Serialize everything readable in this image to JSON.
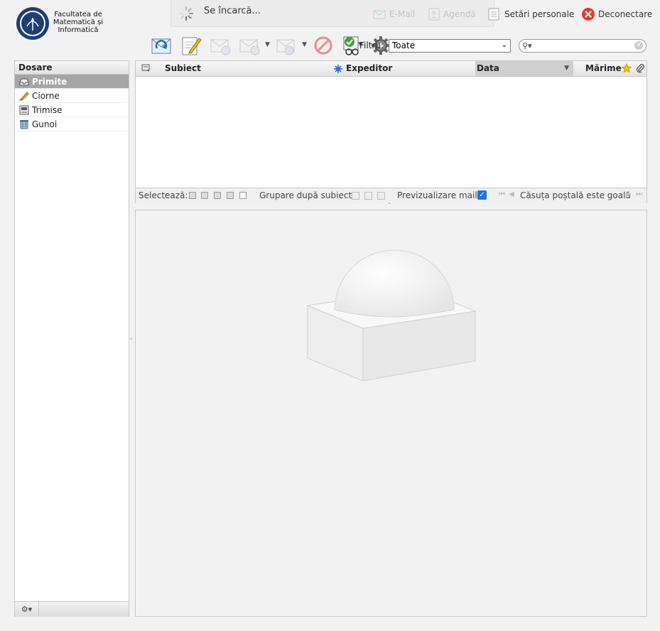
{
  "header": {
    "logo_text": [
      "Facultatea de",
      "Matematică și",
      "Informatică"
    ],
    "loading_text": "Se încarcă...",
    "nav": {
      "email": "E-Mail",
      "agenda": "Agendă",
      "settings": "Setări personale",
      "logout": "Deconectare"
    }
  },
  "toolbar": {
    "buttons": [
      {
        "icon": "refresh-mail-icon",
        "enabled": true
      },
      {
        "icon": "compose-icon",
        "enabled": true
      },
      {
        "icon": "reply-icon",
        "enabled": false
      },
      {
        "icon": "reply-all-icon",
        "enabled": false
      },
      {
        "icon": "forward-icon",
        "enabled": false
      },
      {
        "icon": "delete-icon",
        "enabled": true
      },
      {
        "icon": "mark-icon",
        "enabled": true
      },
      {
        "icon": "more-actions-icon",
        "enabled": true
      }
    ],
    "filter_label": "Filtru:",
    "filter_value": "Toate",
    "search_placeholder": ""
  },
  "folders": {
    "title": "Dosare",
    "items": [
      {
        "label": "Primite",
        "icon": "inbox-icon",
        "selected": true
      },
      {
        "label": "Ciorne",
        "icon": "pencil-icon",
        "selected": false
      },
      {
        "label": "Trimise",
        "icon": "sent-icon",
        "selected": false
      },
      {
        "label": "Gunoi",
        "icon": "trash-icon",
        "selected": false
      }
    ]
  },
  "message_list": {
    "columns": {
      "subject": "Subiect",
      "from": "Expeditor",
      "date": "Data",
      "size": "Mărime"
    },
    "footer": {
      "select_label": "Selectează:",
      "threads_label": "Grupare după subiect:",
      "preview_label": "Previzualizare mail:",
      "preview_checked": true,
      "status": "Căsuța poștală este goală"
    }
  },
  "colors": {
    "background": "#f2f2f2",
    "selected_folder": "#a6a6a6",
    "logout_icon": "#e53935",
    "checkbox": "#1a73e8"
  }
}
